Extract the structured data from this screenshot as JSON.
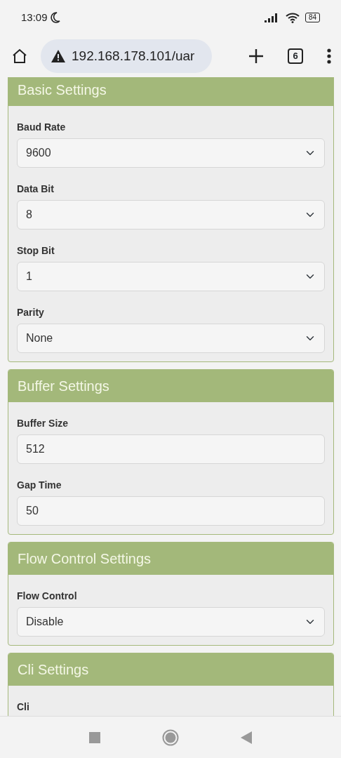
{
  "status_bar": {
    "time": "13:09",
    "battery": "84"
  },
  "browser": {
    "url": "192.168.178.101/uar",
    "tab_count": "6"
  },
  "sections": [
    {
      "title": "Basic Settings",
      "fields": [
        {
          "label": "Baud Rate",
          "kind": "select",
          "value": "9600"
        },
        {
          "label": "Data Bit",
          "kind": "select",
          "value": "8"
        },
        {
          "label": "Stop Bit",
          "kind": "select",
          "value": "1"
        },
        {
          "label": "Parity",
          "kind": "select",
          "value": "None"
        }
      ]
    },
    {
      "title": "Buffer Settings",
      "fields": [
        {
          "label": "Buffer Size",
          "kind": "input",
          "value": "512"
        },
        {
          "label": "Gap Time",
          "kind": "input",
          "value": "50"
        }
      ]
    },
    {
      "title": "Flow Control Settings",
      "fields": [
        {
          "label": "Flow Control",
          "kind": "select",
          "value": "Disable"
        }
      ]
    },
    {
      "title": "Cli Settings",
      "fields": [
        {
          "label": "Cli",
          "kind": "label"
        }
      ]
    }
  ]
}
